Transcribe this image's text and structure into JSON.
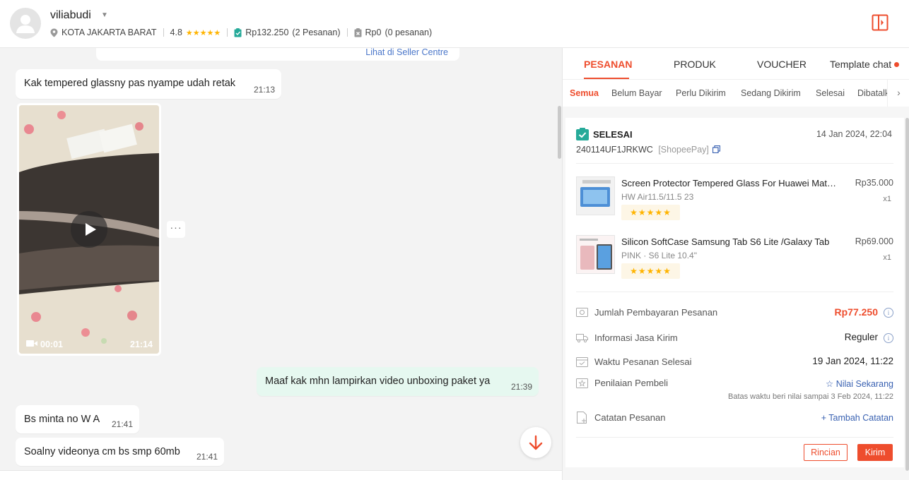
{
  "header": {
    "username": "viliabudi",
    "location": "KOTA JAKARTA BARAT",
    "rating": "4.8",
    "rating_stars": "★★★★★",
    "spent_amount": "Rp132.250",
    "spent_orders": "(2 Pesanan)",
    "refund_amount": "Rp0",
    "refund_orders": "(0 pesanan)"
  },
  "chat": {
    "top_link": "Lihat di Seller Centre",
    "messages": [
      {
        "text": "Kak tempered glassny pas nyampe udah retak",
        "time": "21:13"
      },
      {
        "text": "Maaf kak mhn lampirkan video unboxing paket ya",
        "time": "21:39"
      },
      {
        "text": "Bs minta no W A",
        "time": "21:41"
      },
      {
        "text": "Soalny videonya cm bs smp 60mb",
        "time": "21:41"
      }
    ],
    "video": {
      "duration": "00:01",
      "time": "21:14"
    },
    "more_label": "···"
  },
  "panel": {
    "tabs": [
      "PESANAN",
      "PRODUK",
      "VOUCHER",
      "Template chat"
    ],
    "subtabs": [
      "Semua",
      "Belum Bayar",
      "Perlu Dikirim",
      "Sedang Dikirim",
      "Selesai",
      "Dibatalkan"
    ],
    "order": {
      "status": "SELESAI",
      "date": "14 Jan 2024, 22:04",
      "id": "240114UF1JRKWC",
      "payment": "[ShopeePay]",
      "products": [
        {
          "name": "Screen Protector Tempered Glass For Huawei MatePad",
          "variant": "HW Air11.5/11.5 23",
          "price": "Rp35.000",
          "qty": "x1",
          "stars": "★★★★★"
        },
        {
          "name": "Silicon SoftCase Samsung Tab S6 Lite /Galaxy Tab",
          "variant": "PINK · S6 Lite 10.4\"",
          "price": "Rp69.000",
          "qty": "x1",
          "stars": "★★★★★"
        }
      ],
      "rows": {
        "payment_label": "Jumlah Pembayaran Pesanan",
        "payment_value": "Rp77.250",
        "shipping_label": "Informasi Jasa Kirim",
        "shipping_value": "Reguler",
        "completed_label": "Waktu Pesanan Selesai",
        "completed_value": "19 Jan 2024, 11:22",
        "review_label": "Penilaian Pembeli",
        "review_value": "Nilai Sekarang",
        "review_deadline": "Batas waktu beri nilai sampai 3 Feb 2024, 11:22",
        "notes_label": "Catatan Pesanan",
        "notes_value": "Tambah Catatan"
      },
      "buttons": {
        "detail": "Rincian",
        "send": "Kirim"
      }
    }
  },
  "colors": {
    "accent": "#ee4d2d",
    "link": "#3a62b2",
    "outgoing_bubble": "#e6f8f0",
    "star": "#ffb400"
  }
}
